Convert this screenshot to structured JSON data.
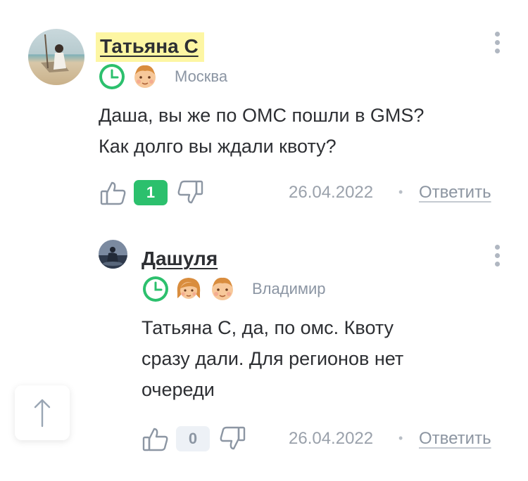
{
  "comments": [
    {
      "author": "Татьяна С",
      "city": "Москва",
      "badges": [
        "clock-badge",
        "boy-badge"
      ],
      "text_lines": [
        "Даша, вы же по ОМС пошли в GMS?",
        "Как долго вы ждали квоту?"
      ],
      "likes": "1",
      "date": "26.04.2022",
      "reply_label": "Ответить"
    },
    {
      "author": "Дашуля",
      "city": "Владимир",
      "badges": [
        "clock-badge",
        "girl-badge",
        "boy-badge"
      ],
      "text_lines": [
        "Татьяна С, да, по омс. Квоту",
        "сразу дали. Для регионов нет",
        "очереди"
      ],
      "likes": "0",
      "date": "26.04.2022",
      "reply_label": "Ответить"
    }
  ],
  "separator": "•",
  "colors": {
    "text": "#2d2f33",
    "muted": "#8b95a3",
    "positive": "#2cc06d",
    "highlight": "#fdf6a3",
    "icon": "#8c96a3"
  },
  "icons": {
    "like": "thumbs-up-icon",
    "dislike": "thumbs-down-icon",
    "menu": "kebab-menu-icon",
    "scroll_top": "arrow-up-icon"
  }
}
